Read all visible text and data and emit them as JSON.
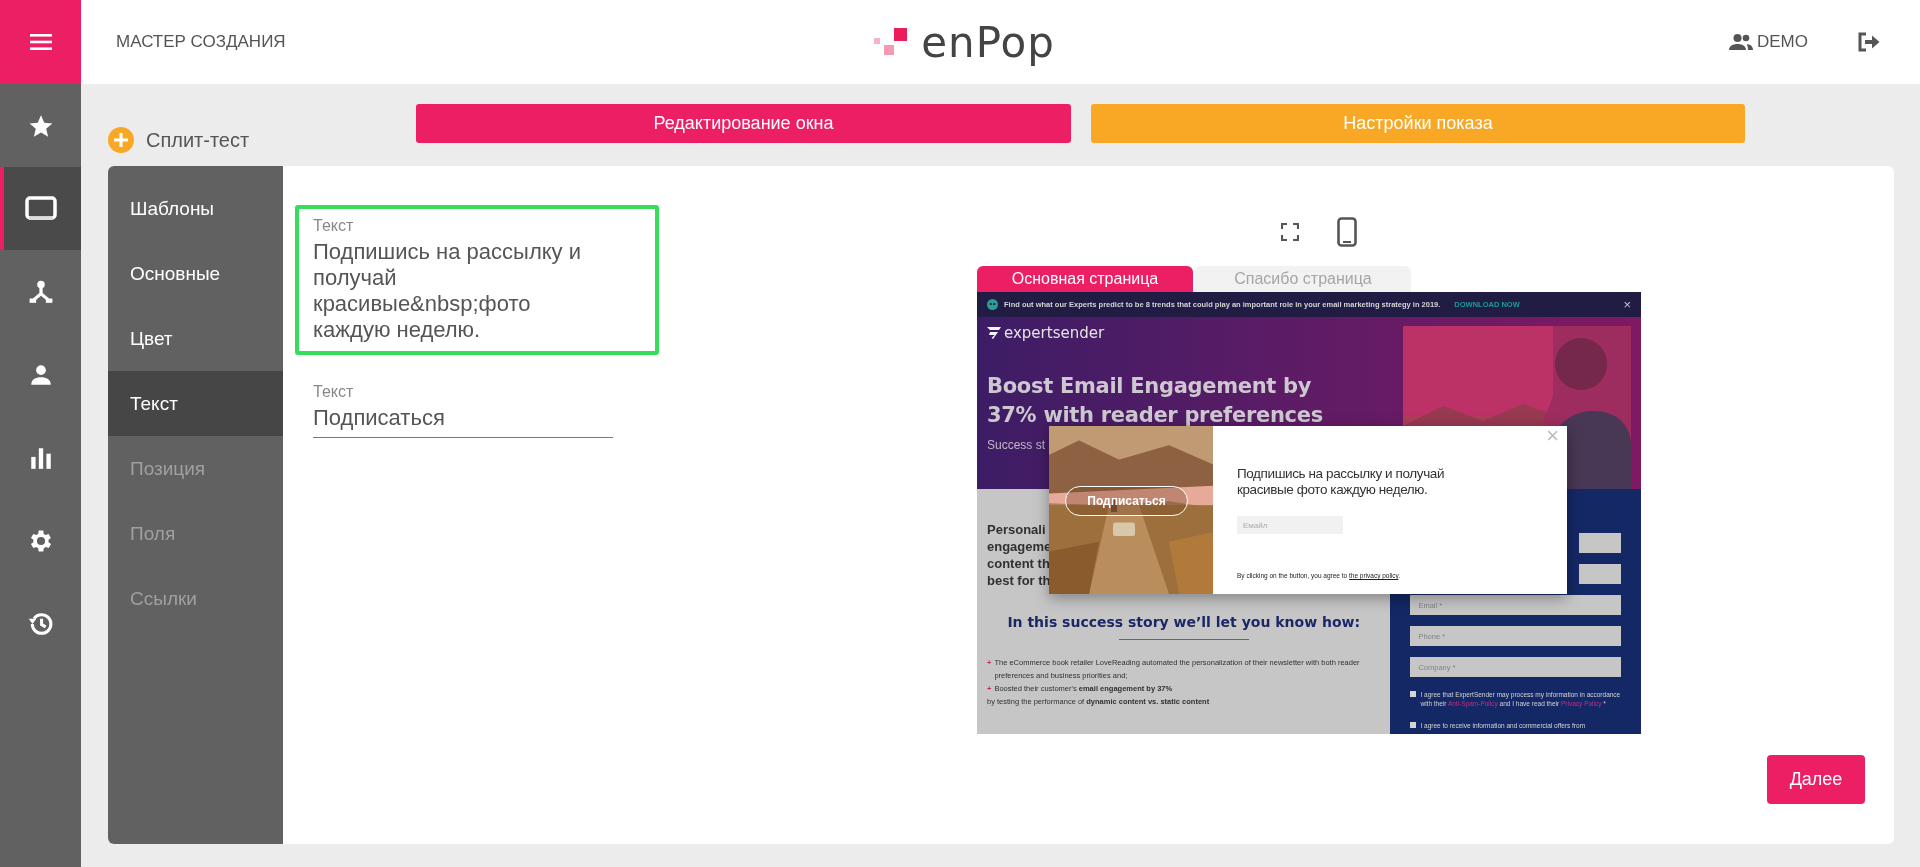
{
  "header": {
    "section_title": "МАСТЕР СОЗДАНИЯ",
    "logo": "enPop",
    "user": "DEMO"
  },
  "rail": [
    {
      "kind": "star",
      "selected": false
    },
    {
      "kind": "monitor",
      "selected": true
    },
    {
      "kind": "network",
      "selected": false
    },
    {
      "kind": "person",
      "selected": false
    },
    {
      "kind": "chart",
      "selected": false
    },
    {
      "kind": "gear",
      "selected": false
    },
    {
      "kind": "history",
      "selected": false
    }
  ],
  "split_test": "Сплит-тест",
  "mode_buttons": [
    {
      "label": "Редактирование окна",
      "kind": "primary"
    },
    {
      "label": "Настройки показа",
      "kind": "secondary"
    }
  ],
  "submenu": [
    {
      "label": "Шаблоны",
      "selected": false,
      "disabled": false
    },
    {
      "label": "Основные",
      "selected": false,
      "disabled": false
    },
    {
      "label": "Цвет",
      "selected": false,
      "disabled": false
    },
    {
      "label": "Текст",
      "selected": true,
      "disabled": false
    },
    {
      "label": "Позиция",
      "selected": false,
      "disabled": true
    },
    {
      "label": "Поля",
      "selected": false,
      "disabled": true
    },
    {
      "label": "Ссылки",
      "selected": false,
      "disabled": true
    }
  ],
  "fields": [
    {
      "label": "Текст",
      "value": "Подпишись на рассылку и получай красивые&nbsp;фото каждую неделю.",
      "focused": true,
      "kind": "multiline"
    },
    {
      "label": "Текст",
      "value": "Подписаться",
      "focused": false,
      "kind": "line"
    }
  ],
  "preview": {
    "tabs": [
      {
        "label": "Основная страница",
        "selected": true
      },
      {
        "label": "Спасибо страница",
        "selected": false
      }
    ],
    "site": {
      "banner": {
        "text": "Find out what our Experts predict to be 8 trends that could play an important role in your email marketing strategy in 2019.",
        "link": "DOWNLOAD NOW",
        "close": "×"
      },
      "logo": "expertsender",
      "title_lines": [
        "Boost Email Engagement by",
        "37% with reader preferences"
      ],
      "subtitle": "Success st",
      "article_lines": [
        "Personali",
        "engageme",
        "content th",
        "best for th"
      ],
      "story_heading": "In this success story we’ll let you know how:",
      "bullets": [
        {
          "mark": "+",
          "text": "The eCommerce book retailer LoveReading automated the personalization of their newsletter with both reader preferences and business priorities and;"
        },
        {
          "mark": "+",
          "text": "Boosted their customer's **email engagement by 37%**"
        }
      ],
      "bullet_tail": "by testing the performance of **dynamic content vs. static content**",
      "form_fields": [
        {
          "kind": "covered"
        },
        {
          "kind": "covered"
        },
        {
          "kind": "field",
          "placeholder": "Email *"
        },
        {
          "kind": "field",
          "placeholder": "Phone *"
        },
        {
          "kind": "field",
          "placeholder": "Company *"
        }
      ],
      "consents": [
        {
          "checked": false,
          "parts": [
            {
              "kind": "text",
              "text": "I agree that ExpertSender may process my information in accordance with their "
            },
            {
              "kind": "link",
              "text": "Anti-Spam-Policy"
            },
            {
              "kind": "text",
              "text": " and I have read their "
            },
            {
              "kind": "link",
              "text": "Privacy Policy"
            },
            {
              "kind": "text",
              "text": " *"
            }
          ]
        },
        {
          "checked": false,
          "parts": [
            {
              "kind": "text",
              "text": "I agree to receive information and commercial offers from"
            }
          ]
        }
      ]
    },
    "popup": {
      "button": "Подписаться",
      "close": "×",
      "text": "Подпишись на рассылку и получай красивые фото каждую неделю.",
      "email_placeholder": "Емайл",
      "consent": [
        {
          "kind": "text",
          "text": "By clicking on the button, you agree to "
        },
        {
          "kind": "link",
          "text": "the privacy policy"
        },
        {
          "kind": "text",
          "text": "."
        }
      ]
    }
  },
  "next_button": "Далее"
}
